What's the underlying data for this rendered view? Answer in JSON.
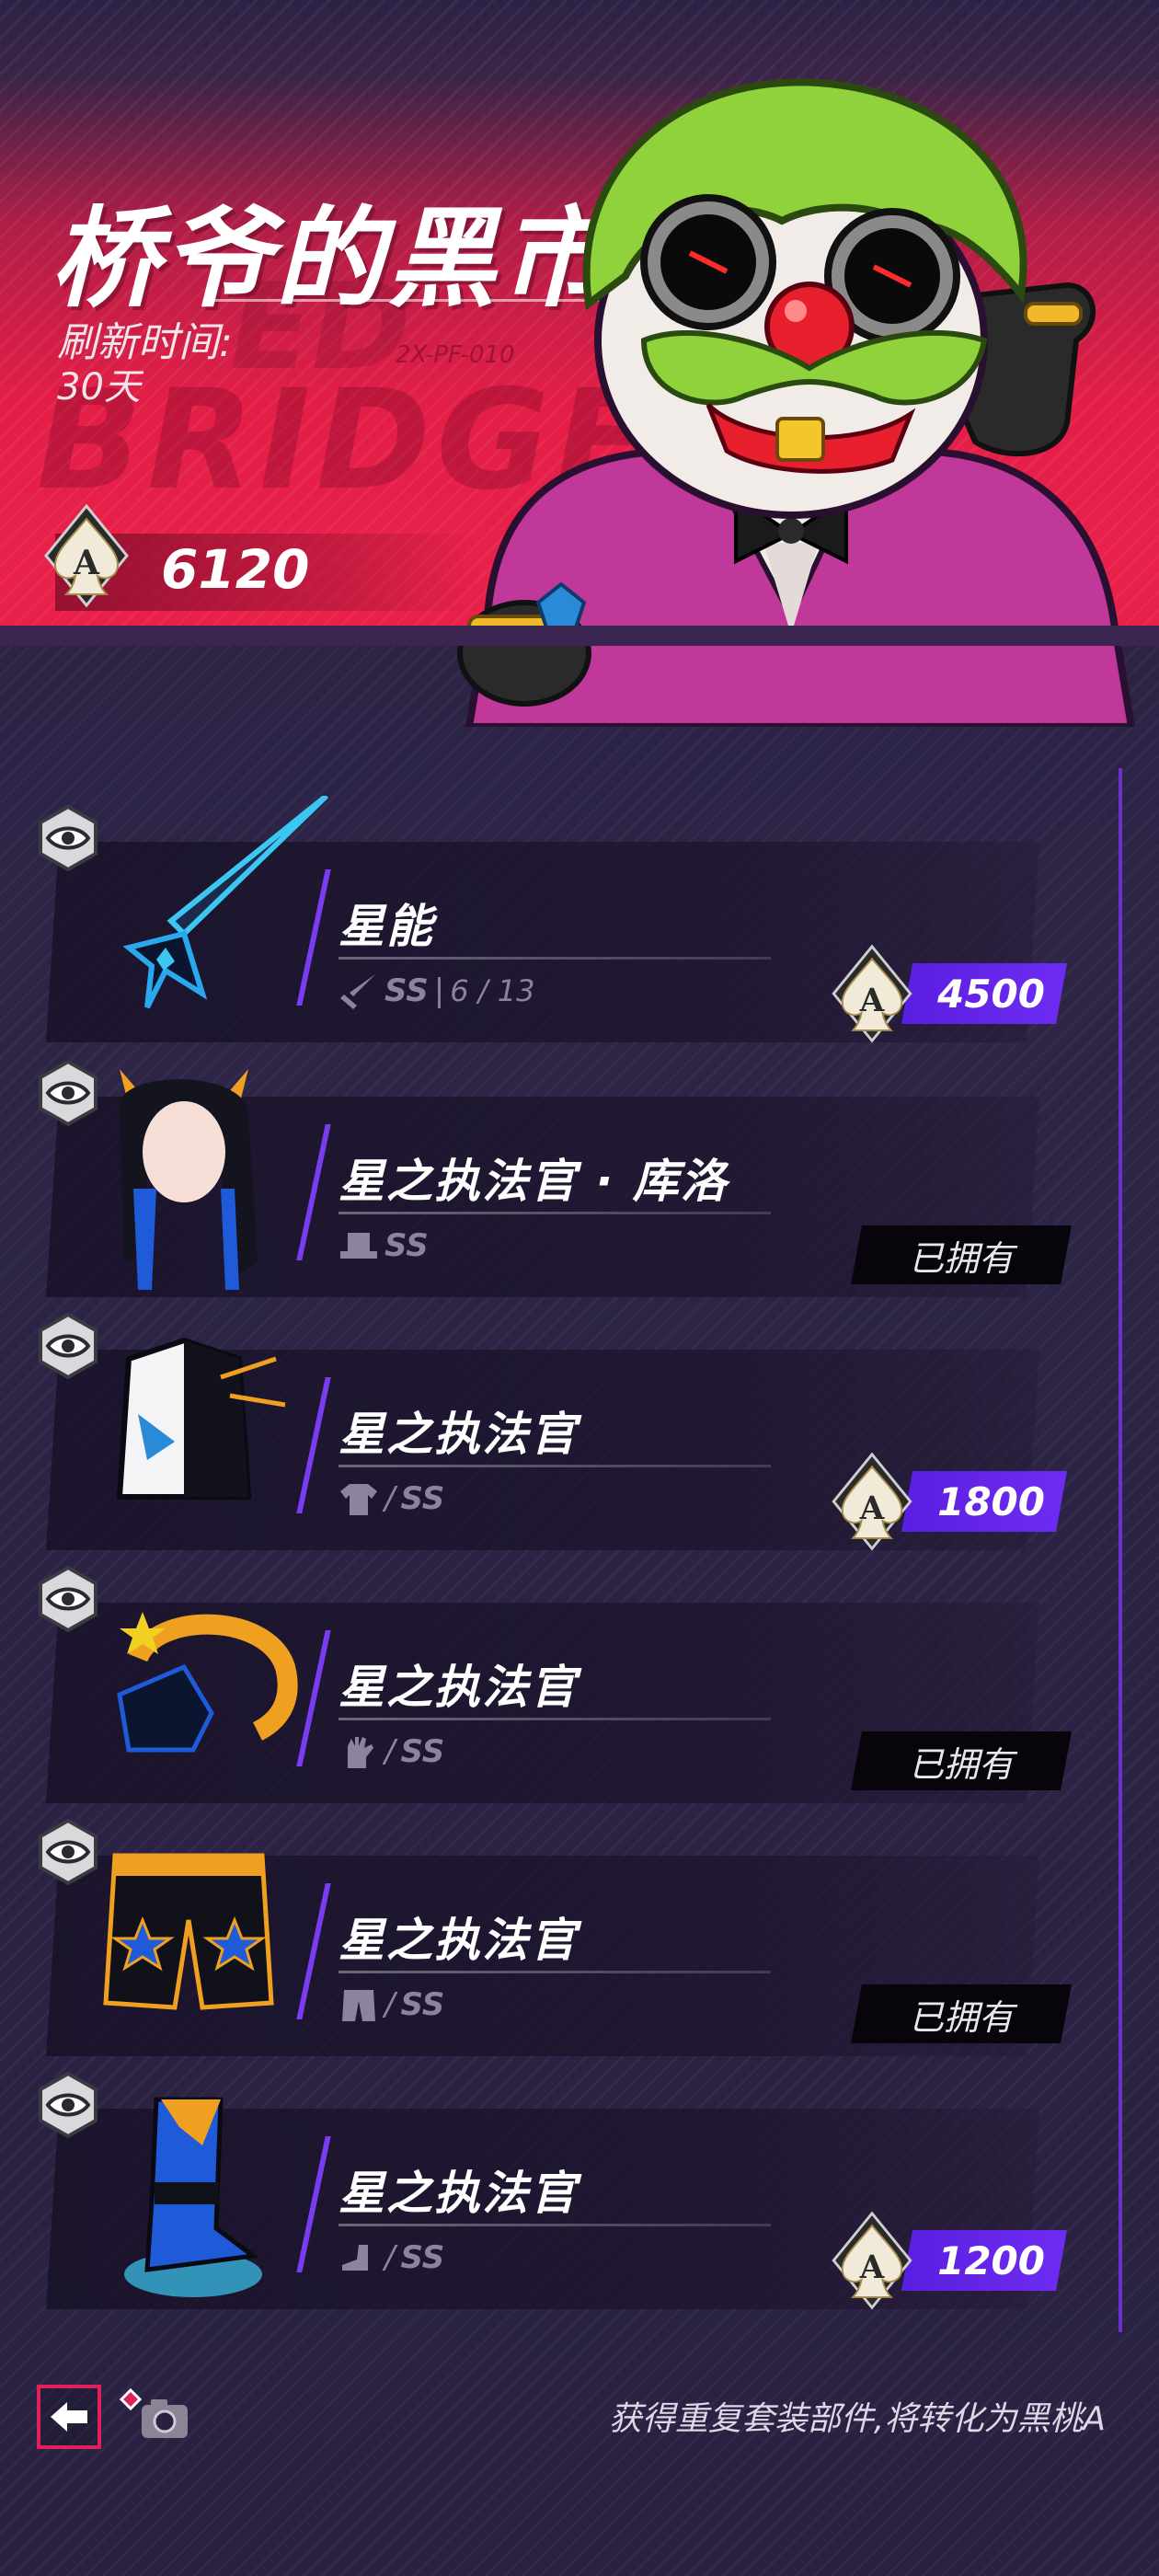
{
  "header": {
    "title": "桥爷的黑市",
    "refresh_label": "刷新时间:",
    "refresh_value": "30天",
    "currency_amount": "6120",
    "currency_icon": "spade-ace-icon"
  },
  "items": [
    {
      "name": "星能",
      "slot_icon": "sword-icon",
      "rank": "SS",
      "extra": "6 / 13",
      "status": "price",
      "price": "4500"
    },
    {
      "name": "星之执法官 · 库洛",
      "slot_icon": "hat-icon",
      "rank": "SS",
      "extra": "",
      "status": "owned",
      "owned_label": "已拥有"
    },
    {
      "name": "星之执法官",
      "slot_icon": "shirt-icon",
      "rank": "SS",
      "extra": "",
      "status": "price",
      "price": "1800"
    },
    {
      "name": "星之执法官",
      "slot_icon": "glove-icon",
      "rank": "SS",
      "extra": "",
      "status": "owned",
      "owned_label": "已拥有"
    },
    {
      "name": "星之执法官",
      "slot_icon": "pants-icon",
      "rank": "SS",
      "extra": "",
      "status": "owned",
      "owned_label": "已拥有"
    },
    {
      "name": "星之执法官",
      "slot_icon": "shoe-icon",
      "rank": "SS",
      "extra": "",
      "status": "price",
      "price": "1200"
    }
  ],
  "footer": {
    "note": "获得重复套装部件,将转化为黑桃A",
    "back_icon": "back-arrow-icon",
    "camera_icon": "camera-icon"
  },
  "colors": {
    "header_red": "#e31e46",
    "accent_purple": "#6e2cf2",
    "owned_bg": "#07050b",
    "page_bg": "#2a2140"
  }
}
